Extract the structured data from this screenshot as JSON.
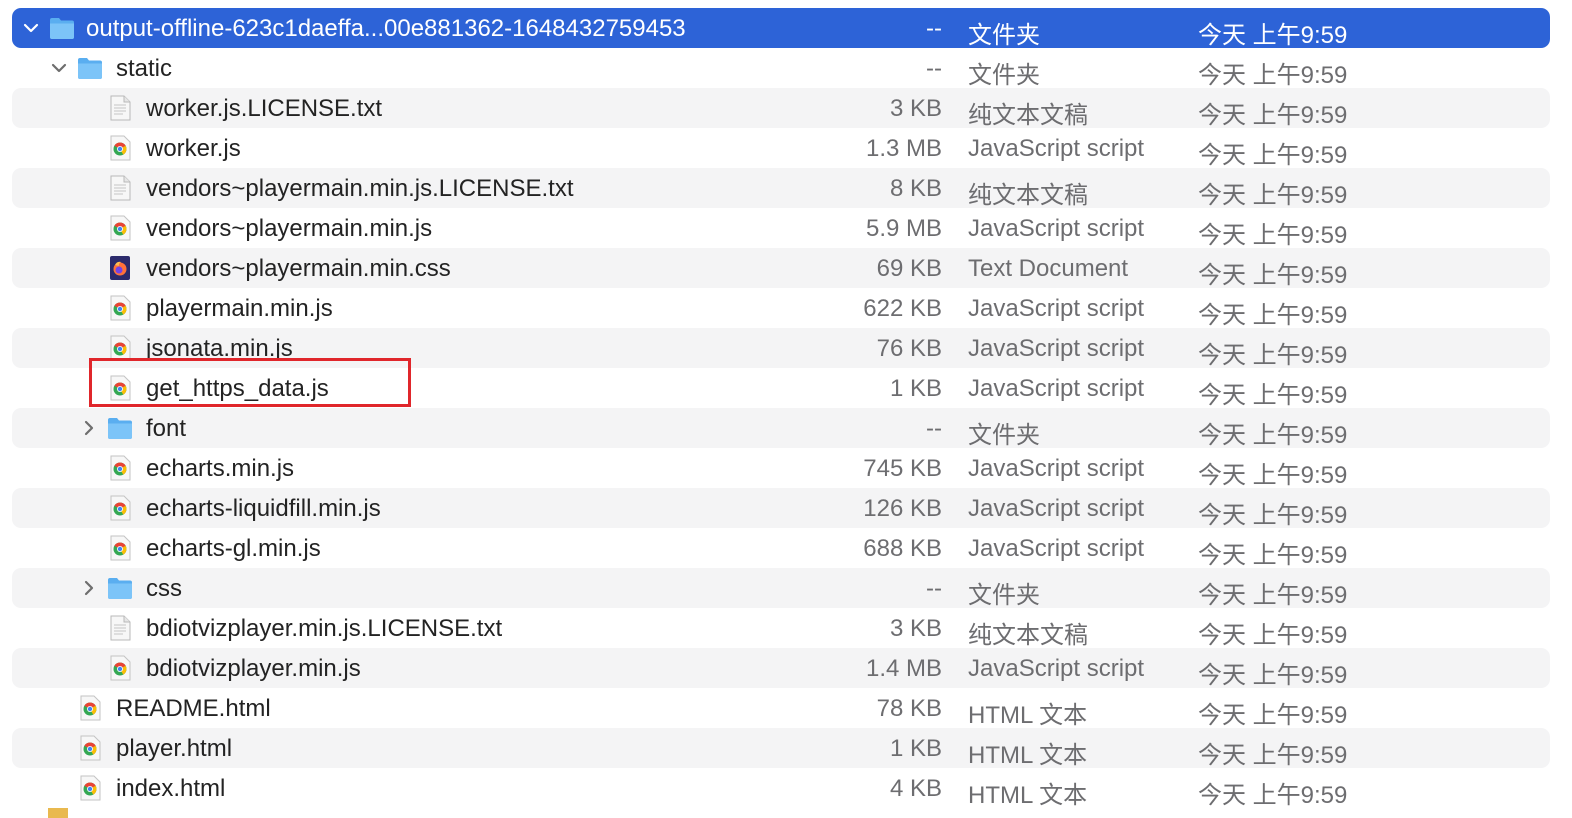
{
  "colors": {
    "selection": "#2d63d7",
    "alt_row": "#f4f4f5",
    "annotation_box": "#e0262b"
  },
  "rows": [
    {
      "name": "output-offline-623c1daeffa...00e881362-1648432759453",
      "size": "--",
      "kind": "文件夹",
      "date": "今天 上午9:59",
      "icon": "folder-icon",
      "level": 0,
      "disclosure": "expanded",
      "selected": true
    },
    {
      "name": "static",
      "size": "--",
      "kind": "文件夹",
      "date": "今天 上午9:59",
      "icon": "folder-icon",
      "level": 1,
      "disclosure": "expanded"
    },
    {
      "name": "worker.js.LICENSE.txt",
      "size": "3 KB",
      "kind": "纯文本文稿",
      "date": "今天 上午9:59",
      "icon": "text-file-icon",
      "level": 2
    },
    {
      "name": "worker.js",
      "size": "1.3 MB",
      "kind": "JavaScript script",
      "date": "今天 上午9:59",
      "icon": "chrome-file-icon",
      "level": 2
    },
    {
      "name": "vendors~playermain.min.js.LICENSE.txt",
      "size": "8 KB",
      "kind": "纯文本文稿",
      "date": "今天 上午9:59",
      "icon": "text-file-icon",
      "level": 2
    },
    {
      "name": "vendors~playermain.min.js",
      "size": "5.9 MB",
      "kind": "JavaScript script",
      "date": "今天 上午9:59",
      "icon": "chrome-file-icon",
      "level": 2
    },
    {
      "name": "vendors~playermain.min.css",
      "size": "69 KB",
      "kind": "Text Document",
      "date": "今天 上午9:59",
      "icon": "firefox-file-icon",
      "level": 2
    },
    {
      "name": "playermain.min.js",
      "size": "622 KB",
      "kind": "JavaScript script",
      "date": "今天 上午9:59",
      "icon": "chrome-file-icon",
      "level": 2
    },
    {
      "name": "jsonata.min.js",
      "size": "76 KB",
      "kind": "JavaScript script",
      "date": "今天 上午9:59",
      "icon": "chrome-file-icon",
      "level": 2
    },
    {
      "name": "get_https_data.js",
      "size": "1 KB",
      "kind": "JavaScript script",
      "date": "今天 上午9:59",
      "icon": "chrome-file-icon",
      "level": 2,
      "annotated": true
    },
    {
      "name": "font",
      "size": "--",
      "kind": "文件夹",
      "date": "今天 上午9:59",
      "icon": "folder-icon",
      "level": 2,
      "disclosure": "collapsed"
    },
    {
      "name": "echarts.min.js",
      "size": "745 KB",
      "kind": "JavaScript script",
      "date": "今天 上午9:59",
      "icon": "chrome-file-icon",
      "level": 2
    },
    {
      "name": "echarts-liquidfill.min.js",
      "size": "126 KB",
      "kind": "JavaScript script",
      "date": "今天 上午9:59",
      "icon": "chrome-file-icon",
      "level": 2
    },
    {
      "name": "echarts-gl.min.js",
      "size": "688 KB",
      "kind": "JavaScript script",
      "date": "今天 上午9:59",
      "icon": "chrome-file-icon",
      "level": 2
    },
    {
      "name": "css",
      "size": "--",
      "kind": "文件夹",
      "date": "今天 上午9:59",
      "icon": "folder-icon",
      "level": 2,
      "disclosure": "collapsed"
    },
    {
      "name": "bdiotvizplayer.min.js.LICENSE.txt",
      "size": "3 KB",
      "kind": "纯文本文稿",
      "date": "今天 上午9:59",
      "icon": "text-file-icon",
      "level": 2
    },
    {
      "name": "bdiotvizplayer.min.js",
      "size": "1.4 MB",
      "kind": "JavaScript script",
      "date": "今天 上午9:59",
      "icon": "chrome-file-icon",
      "level": 2
    },
    {
      "name": "README.html",
      "size": "78 KB",
      "kind": "HTML 文本",
      "date": "今天 上午9:59",
      "icon": "chrome-file-icon",
      "level": 1
    },
    {
      "name": "player.html",
      "size": "1 KB",
      "kind": "HTML 文本",
      "date": "今天 上午9:59",
      "icon": "chrome-file-icon",
      "level": 1
    },
    {
      "name": "index.html",
      "size": "4 KB",
      "kind": "HTML 文本",
      "date": "今天 上午9:59",
      "icon": "chrome-file-icon",
      "level": 1
    }
  ]
}
